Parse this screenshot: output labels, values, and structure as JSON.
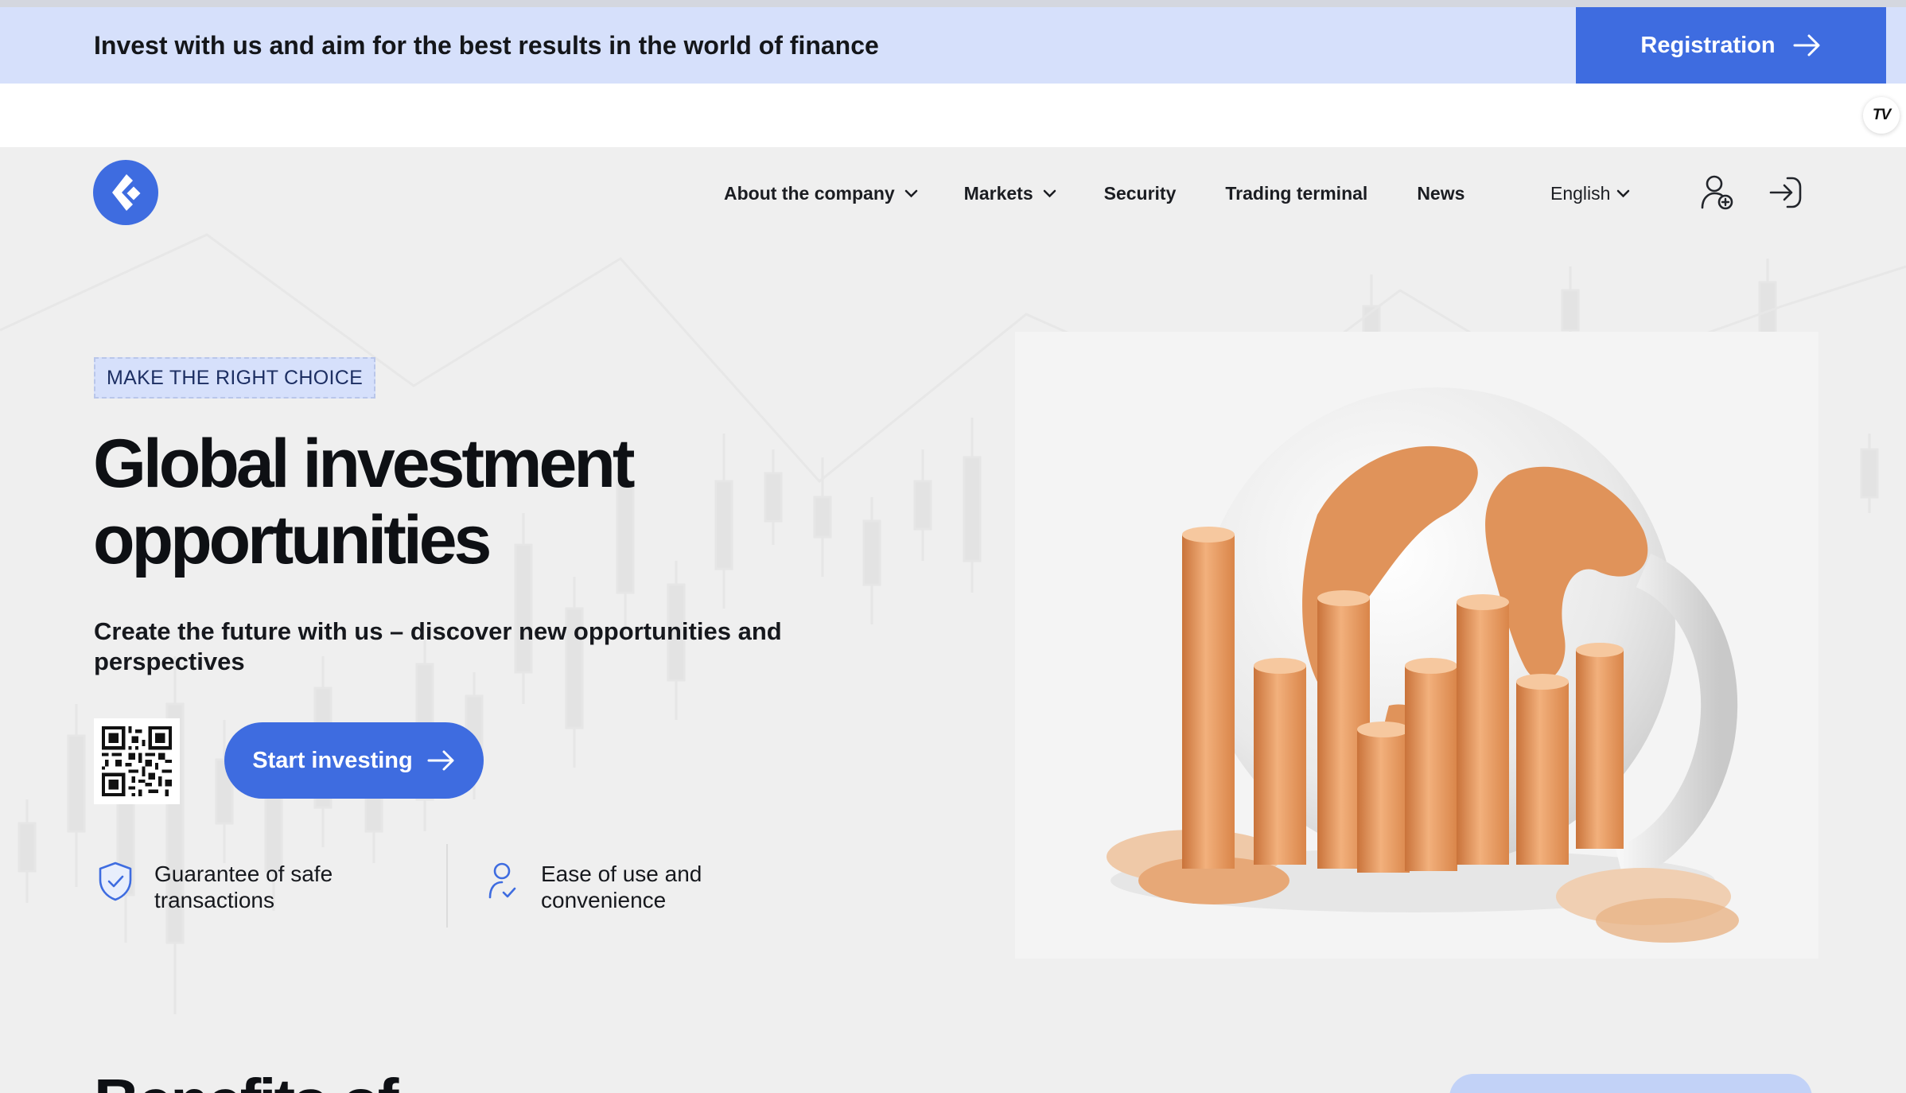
{
  "banner": {
    "text": "Invest with us and aim for the best results in the world of finance",
    "registration_label": "Registration"
  },
  "widget": {
    "tv_badge": "TV"
  },
  "nav": {
    "items": [
      {
        "label": "About the company",
        "has_dropdown": true
      },
      {
        "label": "Markets",
        "has_dropdown": true
      },
      {
        "label": "Security",
        "has_dropdown": false
      },
      {
        "label": "Trading terminal",
        "has_dropdown": false
      },
      {
        "label": "News",
        "has_dropdown": false
      }
    ],
    "language": "English",
    "icons": [
      "logo-icon",
      "user-add-icon",
      "login-icon"
    ]
  },
  "hero": {
    "tag": "MAKE THE RIGHT CHOICE",
    "title_line1": "Global investment",
    "title_line2": "opportunities",
    "subtitle_line1": "Create the future with us – discover new opportunities and",
    "subtitle_line2": "perspectives",
    "start_label": "Start investing",
    "features": [
      {
        "icon": "shield-check-icon",
        "line1": "Guarantee of safe",
        "line2": "transactions"
      },
      {
        "icon": "user-check-icon",
        "line1": "Ease of use and",
        "line2": "convenience"
      }
    ]
  },
  "next_section": {
    "heading_partial": "Benefits of"
  },
  "colors": {
    "accent": "#3e6ce0",
    "banner_bg": "#d6e0fb",
    "hero_bg": "#efefef",
    "copper": "#e0935a"
  }
}
